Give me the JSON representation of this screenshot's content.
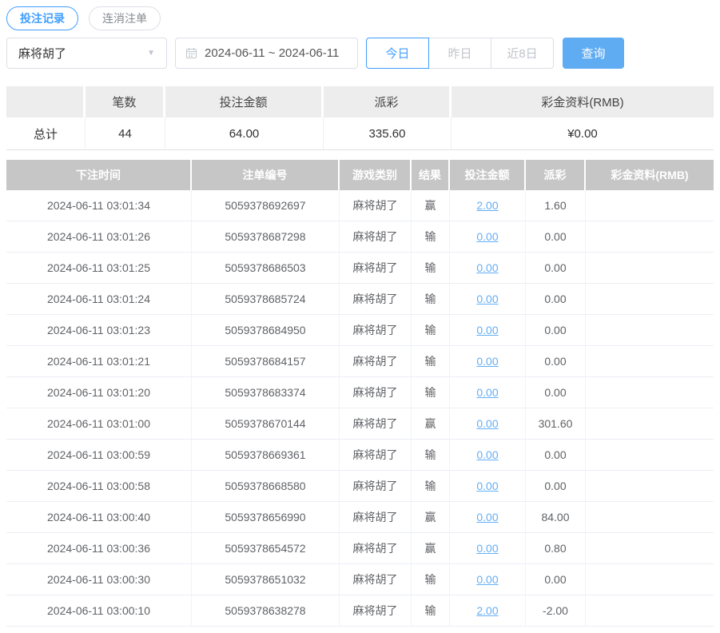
{
  "tabs": [
    {
      "label": "投注记录",
      "active": true
    },
    {
      "label": "连消注单",
      "active": false
    }
  ],
  "filters": {
    "game_select": {
      "value": "麻将胡了"
    },
    "date_range": "2024-06-11 ~ 2024-06-11",
    "quick_buttons": [
      {
        "label": "今日",
        "active": true
      },
      {
        "label": "昨日",
        "active": false
      },
      {
        "label": "近8日",
        "active": false
      }
    ],
    "query_label": "查询"
  },
  "summary": {
    "headers": [
      "",
      "笔数",
      "投注金额",
      "派彩",
      "彩金资料(RMB)"
    ],
    "total": {
      "label": "总计",
      "count": "44",
      "bet_amount": "64.00",
      "payout": "335.60",
      "bonus": "¥0.00"
    }
  },
  "table": {
    "headers": [
      "下注时间",
      "注单编号",
      "游戏类别",
      "结果",
      "投注金额",
      "派彩",
      "彩金资料(RMB)"
    ],
    "rows": [
      {
        "time": "2024-06-11 03:01:34",
        "order_no": "5059378692697",
        "game": "麻将胡了",
        "result": "赢",
        "bet_amount": "2.00",
        "payout": "1.60",
        "bonus": ""
      },
      {
        "time": "2024-06-11 03:01:26",
        "order_no": "5059378687298",
        "game": "麻将胡了",
        "result": "输",
        "bet_amount": "0.00",
        "payout": "0.00",
        "bonus": ""
      },
      {
        "time": "2024-06-11 03:01:25",
        "order_no": "5059378686503",
        "game": "麻将胡了",
        "result": "输",
        "bet_amount": "0.00",
        "payout": "0.00",
        "bonus": ""
      },
      {
        "time": "2024-06-11 03:01:24",
        "order_no": "5059378685724",
        "game": "麻将胡了",
        "result": "输",
        "bet_amount": "0.00",
        "payout": "0.00",
        "bonus": ""
      },
      {
        "time": "2024-06-11 03:01:23",
        "order_no": "5059378684950",
        "game": "麻将胡了",
        "result": "输",
        "bet_amount": "0.00",
        "payout": "0.00",
        "bonus": ""
      },
      {
        "time": "2024-06-11 03:01:21",
        "order_no": "5059378684157",
        "game": "麻将胡了",
        "result": "输",
        "bet_amount": "0.00",
        "payout": "0.00",
        "bonus": ""
      },
      {
        "time": "2024-06-11 03:01:20",
        "order_no": "5059378683374",
        "game": "麻将胡了",
        "result": "输",
        "bet_amount": "0.00",
        "payout": "0.00",
        "bonus": ""
      },
      {
        "time": "2024-06-11 03:01:00",
        "order_no": "5059378670144",
        "game": "麻将胡了",
        "result": "赢",
        "bet_amount": "0.00",
        "payout": "301.60",
        "bonus": ""
      },
      {
        "time": "2024-06-11 03:00:59",
        "order_no": "5059378669361",
        "game": "麻将胡了",
        "result": "输",
        "bet_amount": "0.00",
        "payout": "0.00",
        "bonus": ""
      },
      {
        "time": "2024-06-11 03:00:58",
        "order_no": "5059378668580",
        "game": "麻将胡了",
        "result": "输",
        "bet_amount": "0.00",
        "payout": "0.00",
        "bonus": ""
      },
      {
        "time": "2024-06-11 03:00:40",
        "order_no": "5059378656990",
        "game": "麻将胡了",
        "result": "赢",
        "bet_amount": "0.00",
        "payout": "84.00",
        "bonus": ""
      },
      {
        "time": "2024-06-11 03:00:36",
        "order_no": "5059378654572",
        "game": "麻将胡了",
        "result": "赢",
        "bet_amount": "0.00",
        "payout": "0.80",
        "bonus": ""
      },
      {
        "time": "2024-06-11 03:00:30",
        "order_no": "5059378651032",
        "game": "麻将胡了",
        "result": "输",
        "bet_amount": "0.00",
        "payout": "0.00",
        "bonus": ""
      },
      {
        "time": "2024-06-11 03:00:10",
        "order_no": "5059378638278",
        "game": "麻将胡了",
        "result": "输",
        "bet_amount": "2.00",
        "payout": "-2.00",
        "bonus": ""
      }
    ]
  },
  "colors": {
    "accent": "#409eff",
    "button_blue": "#5facf2",
    "link_blue": "#64aef5",
    "header_gray": "#c6c6c6",
    "negative_red": "#f25b5b"
  }
}
